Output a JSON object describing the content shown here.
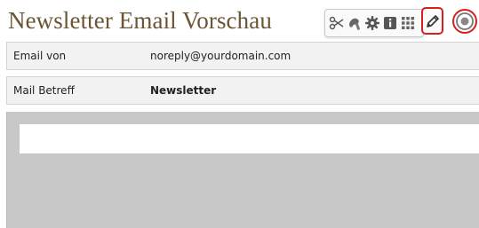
{
  "header": {
    "title": "Newsletter Email Vorschau"
  },
  "toolbar": {
    "icons": [
      "scissors-icon",
      "brush-icon",
      "gear-icon",
      "info-icon",
      "grid-icon"
    ],
    "edit_icon": "pencil-icon",
    "target_icon": "target-icon",
    "highlight_color": "#d62020"
  },
  "fields": {
    "from_label": "Email von",
    "from_value": "noreply@yourdomain.com",
    "subject_label": "Mail Betreff",
    "subject_value": "Newsletter"
  }
}
